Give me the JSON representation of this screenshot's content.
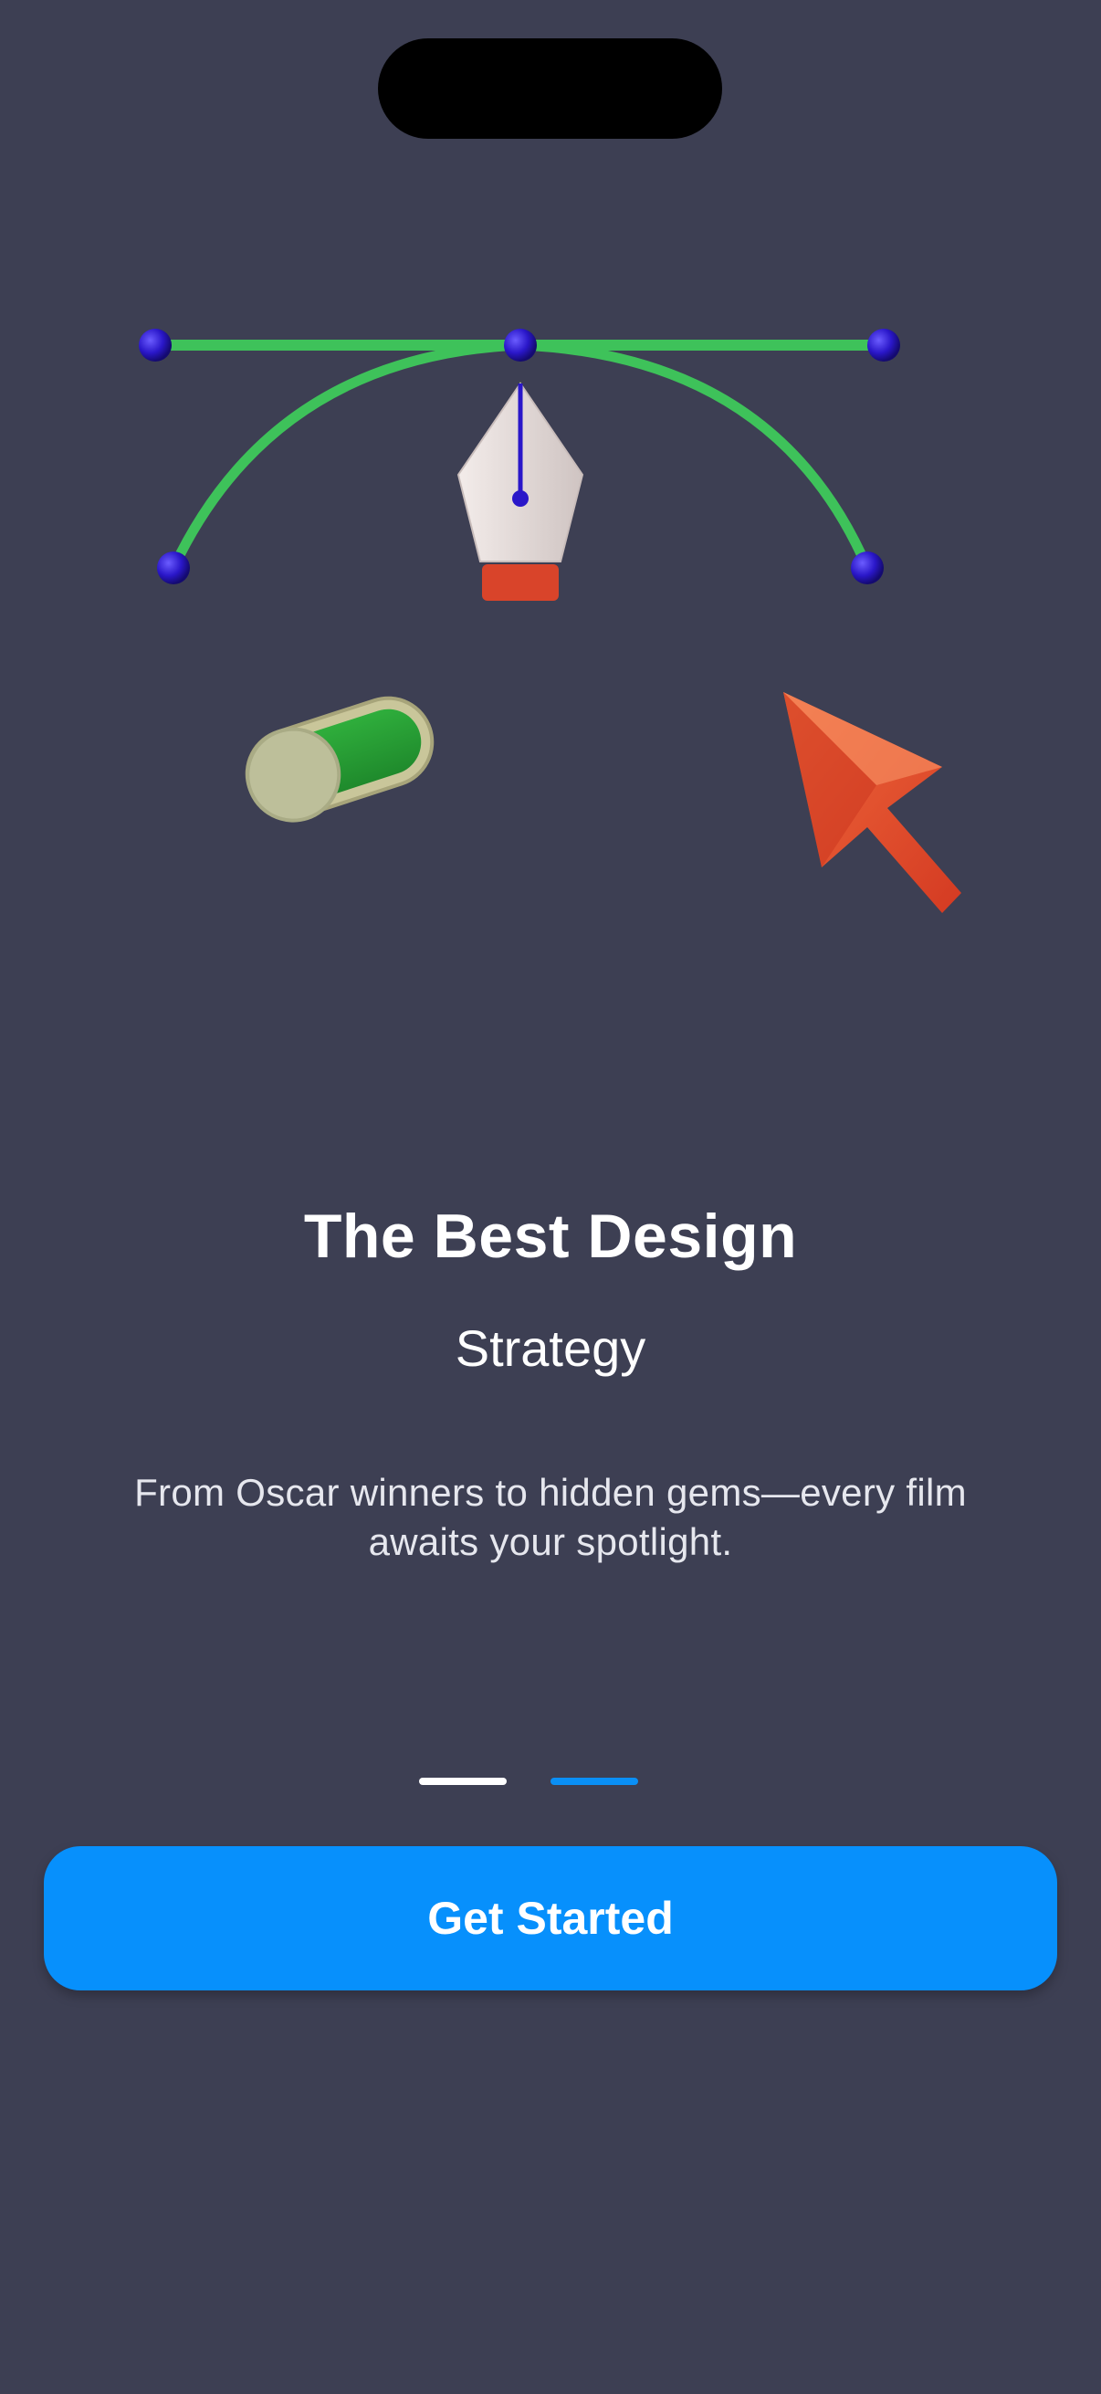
{
  "onboarding": {
    "title": "The Best Design",
    "subtitle": "Strategy",
    "description": "From Oscar winners to hidden gems—every film awaits your spotlight.",
    "illustration_icons": [
      "bezier-pen-icon",
      "toggle-switch-icon",
      "cursor-arrow-icon"
    ]
  },
  "pager": {
    "total_pages": 2,
    "active_page": 2
  },
  "cta": {
    "label": "Get Started"
  },
  "colors": {
    "background": "#3d3f53",
    "accent": "#0790fc",
    "curve_green": "#3ec25a",
    "node_blue": "#2a17c9",
    "cursor_orange": "#e1502e"
  }
}
